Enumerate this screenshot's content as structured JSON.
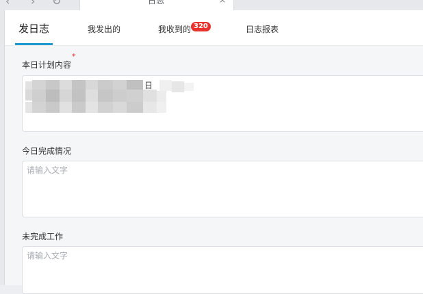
{
  "browser": {
    "tab_title": "日志",
    "close_glyph": "×"
  },
  "tabs": [
    {
      "label": "发日志"
    },
    {
      "label": "我发出的"
    },
    {
      "label": "我收到的"
    },
    {
      "label": "日志报表"
    }
  ],
  "received_badge": "320",
  "form": {
    "plan": {
      "label": "本日计划内容",
      "required_mark": "*",
      "blurred_fragment": "日"
    },
    "done": {
      "label": "今日完成情况",
      "placeholder": "请输入文字"
    },
    "undone": {
      "label": "未完成工作",
      "placeholder": "请输入文字"
    }
  },
  "colors": {
    "accent": "#1d9bd1",
    "badge": "#e8322d",
    "required": "#e8322d"
  }
}
